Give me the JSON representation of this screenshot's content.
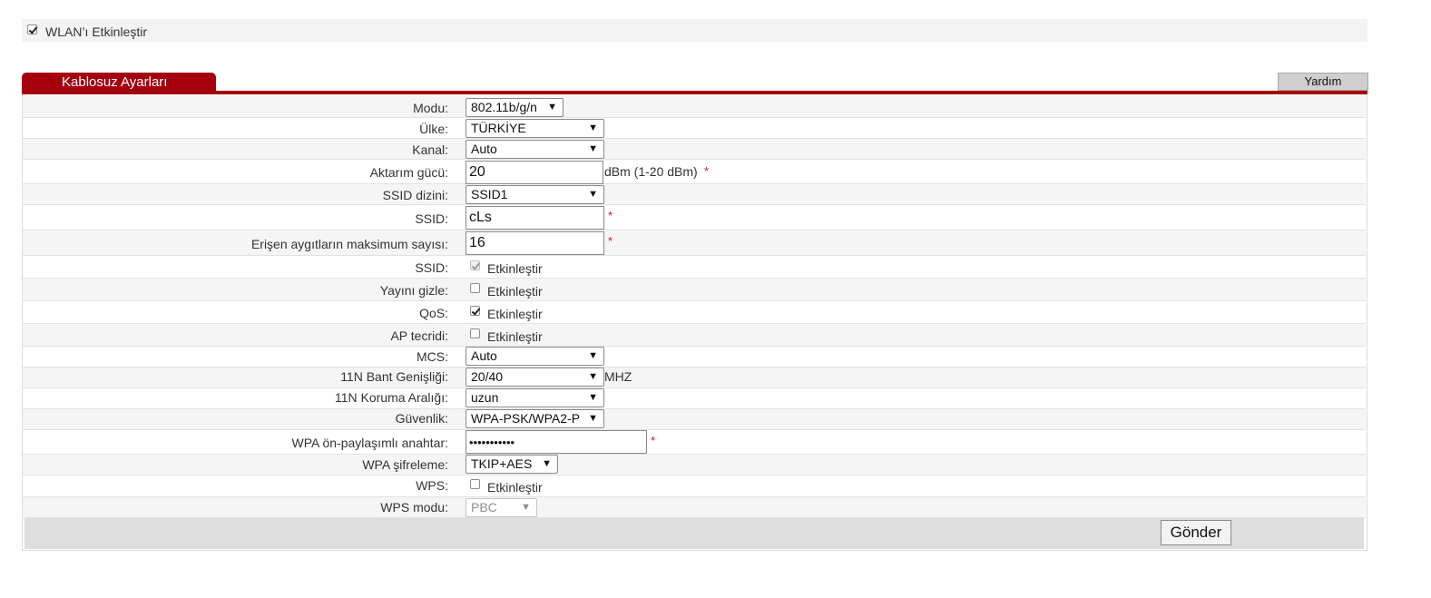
{
  "wlan": {
    "enable_label": "WLAN’ı Etkinleştir",
    "enabled": true
  },
  "panel": {
    "title": "Kablosuz Ayarları",
    "help_label": "Yardım"
  },
  "form": {
    "mode": {
      "label": "Modu:",
      "value": "802.11b/g/n"
    },
    "country": {
      "label": "Ülke:",
      "value": "TÜRKİYE"
    },
    "channel": {
      "label": "Kanal:",
      "value": "Auto"
    },
    "tx_power": {
      "label": "Aktarım gücü:",
      "value": "20",
      "suffix": "dBm (1-20 dBm)",
      "required": "*"
    },
    "ssid_index": {
      "label": "SSID dizini:",
      "value": "SSID1"
    },
    "ssid": {
      "label": "SSID:",
      "value": "cLs",
      "required": "*"
    },
    "max_devices": {
      "label": "Erişen aygıtların maksimum sayısı:",
      "value": "16",
      "required": "*"
    },
    "ssid_enable": {
      "label": "SSID:",
      "option": "Etkinleştir",
      "checked": true
    },
    "hide_broadcast": {
      "label": "Yayını gizle:",
      "option": "Etkinleştir",
      "checked": false
    },
    "qos": {
      "label": "QoS:",
      "option": "Etkinleştir",
      "checked": true
    },
    "ap_isolation": {
      "label": "AP tecridi:",
      "option": "Etkinleştir",
      "checked": false
    },
    "mcs": {
      "label": "MCS:",
      "value": "Auto"
    },
    "bandwidth_11n": {
      "label": "11N Bant Genişliği:",
      "value": "20/40",
      "suffix": "MHZ"
    },
    "guard_interval_11n": {
      "label": "11N Koruma Aralığı:",
      "value": "uzun"
    },
    "security": {
      "label": "Güvenlik:",
      "value": "WPA-PSK/WPA2-P"
    },
    "wpa_psk": {
      "label": "WPA ön-paylaşımlı anahtar:",
      "value": "•••••••••••",
      "required": "*"
    },
    "wpa_encryption": {
      "label": "WPA şifreleme:",
      "value": "TKIP+AES"
    },
    "wps": {
      "label": "WPS:",
      "option": "Etkinleştir",
      "checked": false
    },
    "wps_mode": {
      "label": "WPS modu:",
      "value": "PBC"
    }
  },
  "actions": {
    "submit_label": "Gönder"
  }
}
